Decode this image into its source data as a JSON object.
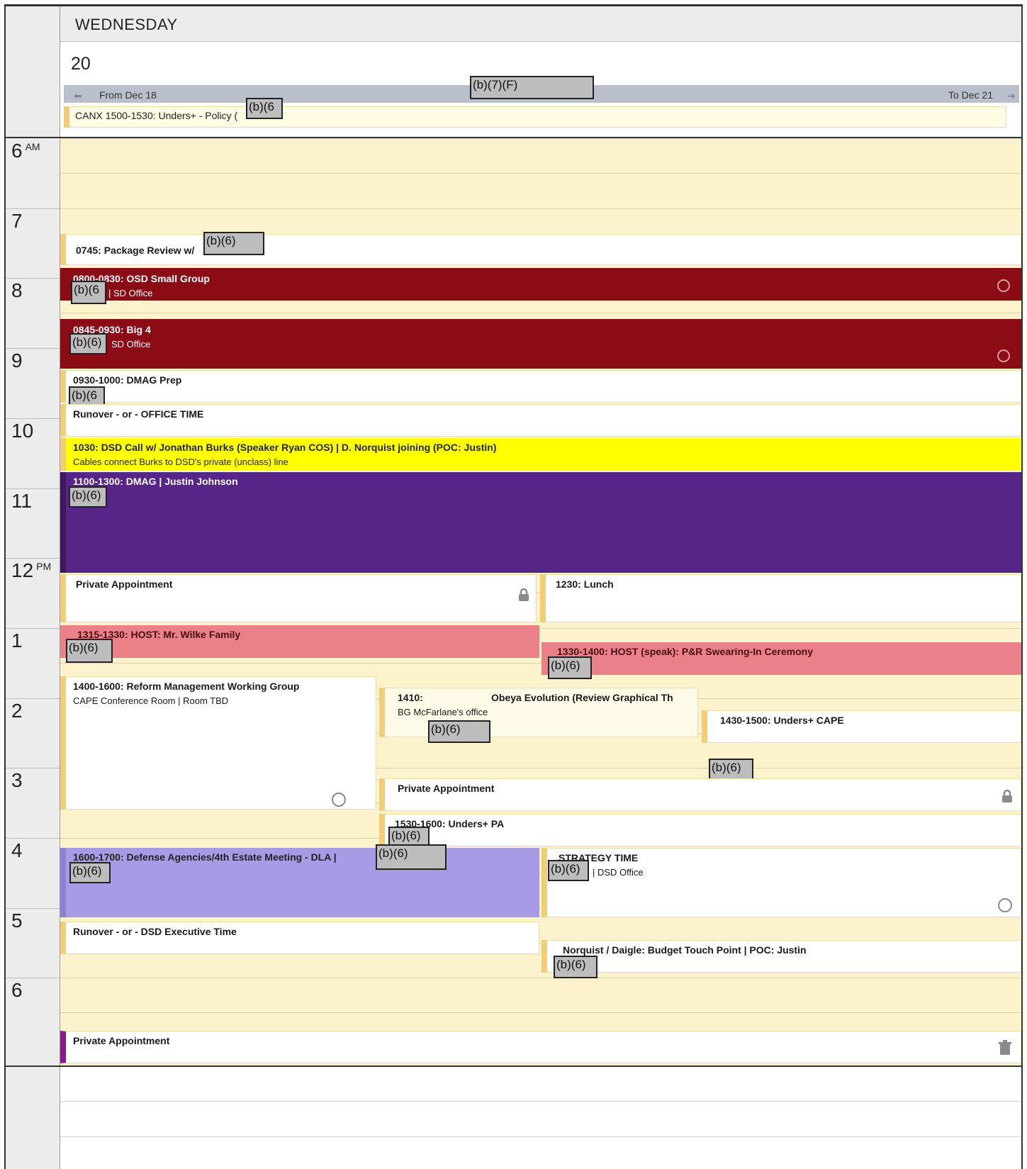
{
  "day": {
    "name": "WEDNESDAY",
    "number": "20"
  },
  "range": {
    "from": "From Dec 18",
    "to": "To Dec 21",
    "redaction": "(b)(7)(F)"
  },
  "allday": {
    "text": "CANX 1500-1530: Unders+ - Policy (",
    "redaction": "(b)(6"
  },
  "hours": [
    {
      "label": "6",
      "ampm": "AM"
    },
    {
      "label": "7"
    },
    {
      "label": "8"
    },
    {
      "label": "9"
    },
    {
      "label": "10"
    },
    {
      "label": "11"
    },
    {
      "label": "12",
      "ampm": "PM"
    },
    {
      "label": "1"
    },
    {
      "label": "2"
    },
    {
      "label": "3"
    },
    {
      "label": "4"
    },
    {
      "label": "5"
    },
    {
      "label": "6"
    }
  ],
  "events": {
    "package_review": {
      "title": "0745: Package Review w/",
      "redaction": "(b)(6)"
    },
    "osd_small_group": {
      "title": "0800-0830: OSD Small Group",
      "sub": "| SD Office",
      "redaction": "(b)(6"
    },
    "big4": {
      "title": "0845-0930: Big 4",
      "sub": "SD Office",
      "redaction": "(b)(6)"
    },
    "dmag_prep": {
      "title": "0930-1000: DMAG Prep",
      "redaction": "(b)(6"
    },
    "runover_office": {
      "title": "Runover - or - OFFICE TIME"
    },
    "dsd_call": {
      "title": "1030: DSD Call w/ Jonathan Burks (Speaker Ryan COS) | D. Norquist joining (POC: Justin)",
      "sub": "Cables connect Burks to DSD's private (unclass) line"
    },
    "dmag": {
      "title": "1100-1300: DMAG | Justin Johnson",
      "redaction": "(b)(6)"
    },
    "private1": {
      "title": "Private Appointment"
    },
    "lunch": {
      "title": "1230: Lunch"
    },
    "host_wilke": {
      "title": "1315-1330: HOST: Mr. Wilke Family",
      "redaction": "(b)(6)"
    },
    "host_swearing": {
      "title": "1330-1400: HOST (speak): P&R Swearing-In Ceremony",
      "redaction": "(b)(6)"
    },
    "reform": {
      "title": "1400-1600: Reform Management Working Group",
      "sub": "CAPE Conference Room | Room TBD"
    },
    "obeya": {
      "title_a": "1410:",
      "title_b": "Obeya Evolution (Review Graphical Th",
      "sub": "BG McFarlane's office",
      "redaction": "(b)(6)"
    },
    "unders_cape": {
      "title": "1430-1500: Unders+ CAPE",
      "redaction": "(b)(6)"
    },
    "private2": {
      "title": "Private Appointment"
    },
    "unders_pa": {
      "title": "1530-1600: Unders+ PA",
      "redaction": "(b)(6)"
    },
    "defense_agencies": {
      "title": "1600-1700: Defense Agencies/4th Estate Meeting - DLA |",
      "redaction_a": "(b)(6)",
      "redaction_b": "(b)(6)"
    },
    "strategy": {
      "title": "STRATEGY TIME",
      "sub": "| DSD Office",
      "redaction": "(b)(6)"
    },
    "runover_dsd": {
      "title": "Runover - or - DSD Executive Time"
    },
    "norquist": {
      "title": "Norquist / Daigle: Budget Touch Point | POC: Justin",
      "redaction": "(b)(6)"
    },
    "private3": {
      "title": "Private Appointment"
    }
  },
  "colors": {
    "dark_red": "#8c0c16",
    "pink": "#ea8088",
    "yellow": "#ffff00",
    "purple": "#572488",
    "lavender": "#a89be6",
    "cream": "#fcf2cc",
    "accent": "#f1cd78"
  }
}
